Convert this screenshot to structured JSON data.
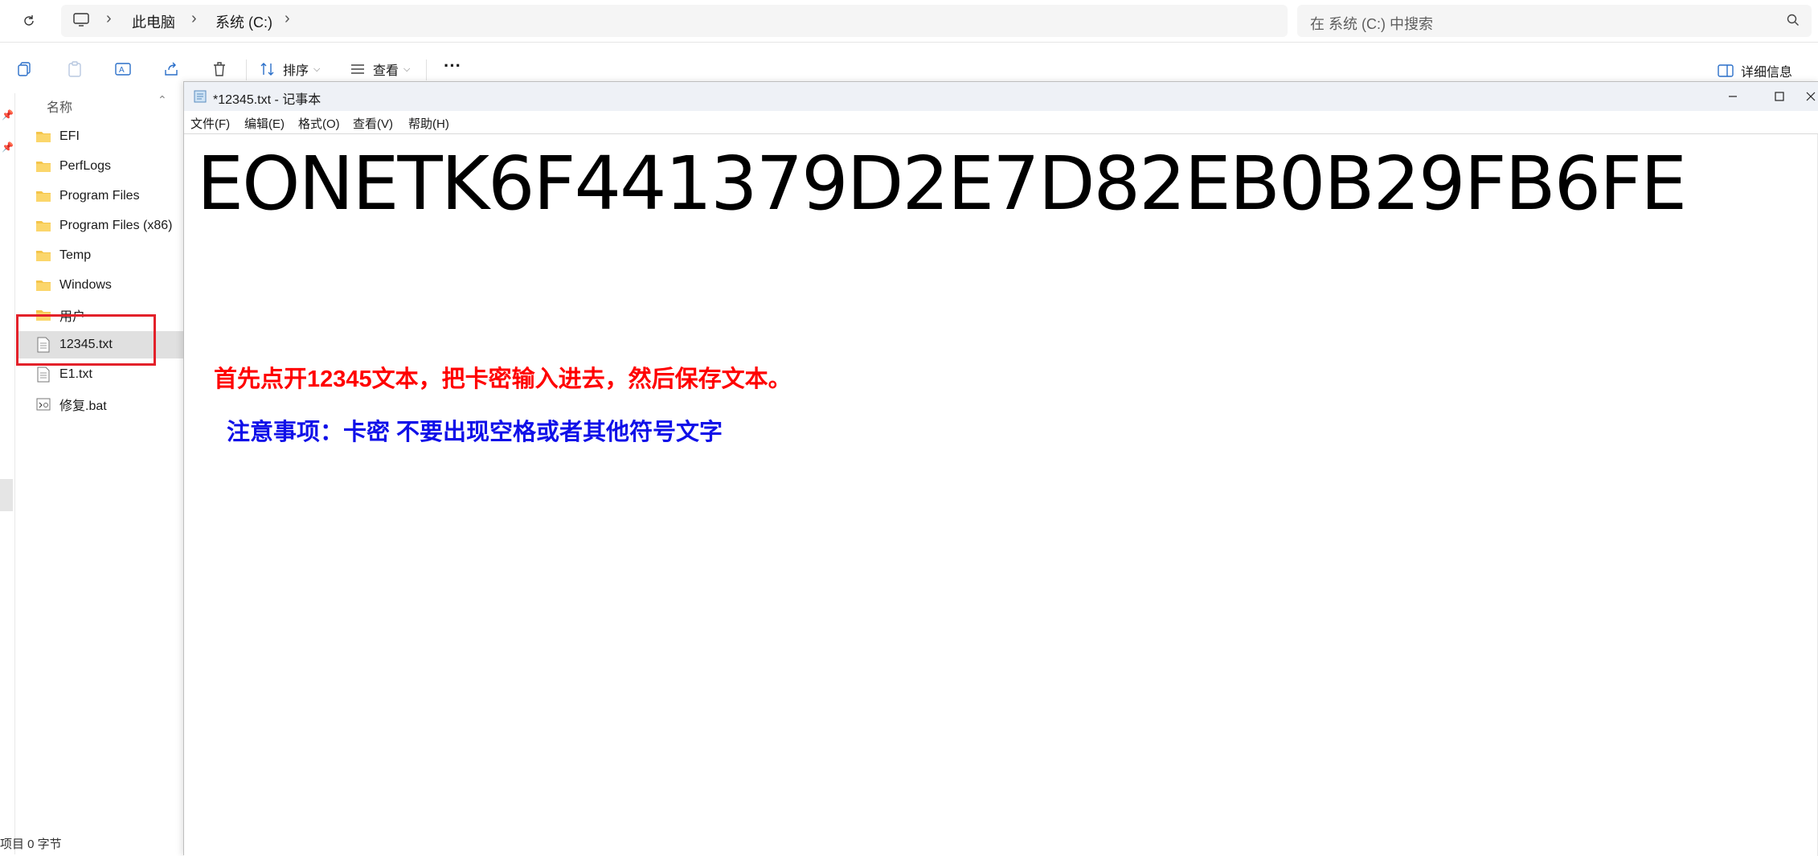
{
  "address_bar": {
    "crumbs": [
      "此电脑",
      "系统 (C:)"
    ],
    "search_placeholder": "在 系统 (C:) 中搜索"
  },
  "command_bar": {
    "sort_label": "排序",
    "view_label": "查看",
    "more_label": "···",
    "details_label": "详细信息"
  },
  "file_list": {
    "column_name": "名称",
    "items": [
      {
        "name": "EFI",
        "type": "folder"
      },
      {
        "name": "PerfLogs",
        "type": "folder"
      },
      {
        "name": "Program Files",
        "type": "folder"
      },
      {
        "name": "Program Files (x86)",
        "type": "folder"
      },
      {
        "name": "Temp",
        "type": "folder"
      },
      {
        "name": "Windows",
        "type": "folder"
      },
      {
        "name": "用户",
        "type": "folder"
      },
      {
        "name": "12345.txt",
        "type": "txt",
        "selected": true
      },
      {
        "name": "E1.txt",
        "type": "txt"
      },
      {
        "name": "修复.bat",
        "type": "bat"
      }
    ],
    "status": "项目   0 字节"
  },
  "notepad": {
    "title": "*12345.txt - 记事本",
    "menu": [
      "文件(F)",
      "编辑(E)",
      "格式(O)",
      "查看(V)",
      "帮助(H)"
    ],
    "content_key": "EONETK6F441379D2E7D82EB0B29FB6FE",
    "instruction_red": "首先点开12345文本，把卡密输入进去，然后保存文本。",
    "instruction_blue": "注意事项：卡密 不要出现空格或者其他符号文字"
  },
  "colors": {
    "highlight_box": "#e3212a",
    "instruction_red": "#ff0000",
    "instruction_blue": "#1010e8",
    "folder_yellow": "#f4c54b"
  }
}
